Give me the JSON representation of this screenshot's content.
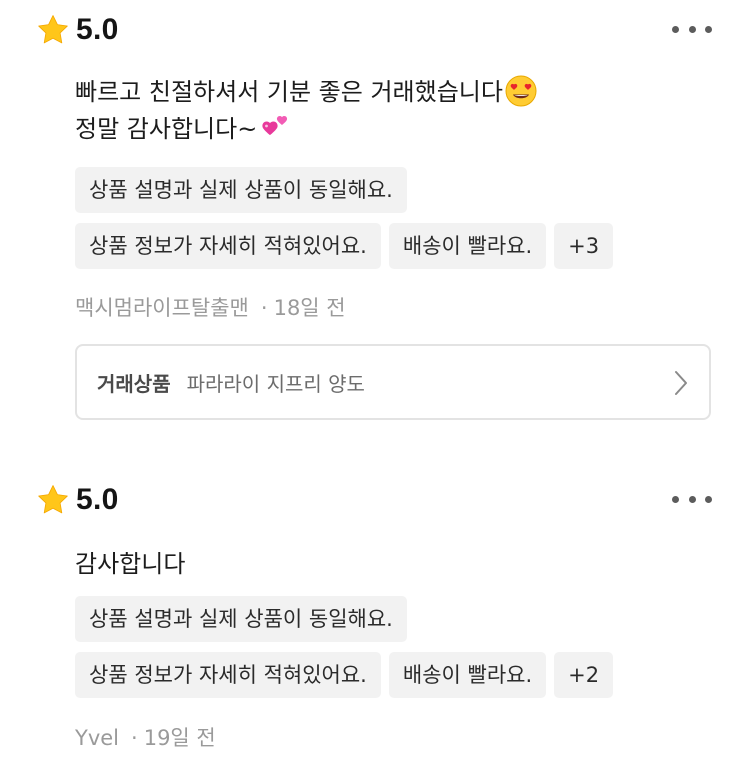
{
  "reviews": [
    {
      "rating_text": "5.0",
      "rating_value": 5.0,
      "body_lines": [
        "빠르고 친절하셔서 기분 좋은 거래했습니다",
        "정말 감사합니다~"
      ],
      "body_emojis": [
        "smiling-face-with-heart-eyes",
        "two-hearts"
      ],
      "tags_row1": [
        "상품 설명과 실제 상품이 동일해요."
      ],
      "tags_row2": [
        "상품 정보가 자세히 적혀있어요.",
        "배송이 빨라요.",
        "+3"
      ],
      "author": "맥시멈라이프탈출맨",
      "separator": "·",
      "time_ago": "18일 전",
      "product": {
        "label": "거래상품",
        "name": "파라라이 지프리 양도"
      }
    },
    {
      "rating_text": "5.0",
      "rating_value": 5.0,
      "body_lines": [
        "감사합니다"
      ],
      "tags_row1": [
        "상품 설명과 실제 상품이 동일해요."
      ],
      "tags_row2": [
        "상품 정보가 자세히 적혀있어요.",
        "배송이 빨라요.",
        "+2"
      ],
      "author": "Yvel",
      "separator": "·",
      "time_ago": "19일 전"
    }
  ],
  "icons": {
    "rating": "star-icon",
    "menu": "more-dots-icon",
    "product_link": "chevron-right-icon"
  },
  "colors": {
    "star": "#FFC61A",
    "tag_bg": "#F2F2F2",
    "meta_text": "#9A9A9A",
    "border": "#E3E3E3"
  }
}
